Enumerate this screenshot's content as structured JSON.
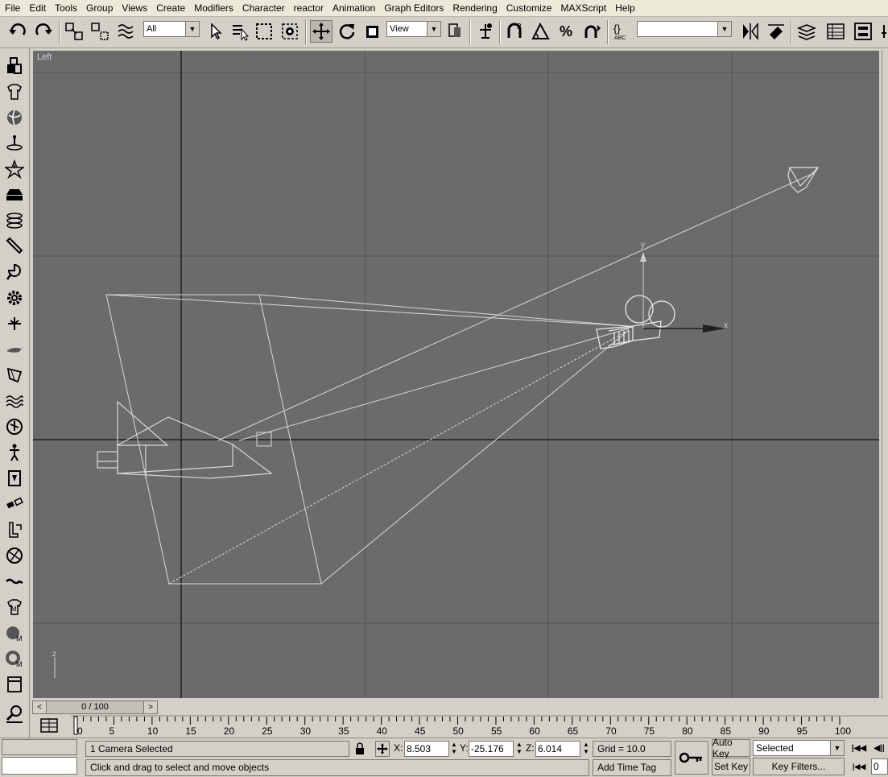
{
  "menu": [
    "File",
    "Edit",
    "Tools",
    "Group",
    "Views",
    "Create",
    "Modifiers",
    "Character",
    "reactor",
    "Animation",
    "Graph Editors",
    "Rendering",
    "Customize",
    "MAXScript",
    "Help"
  ],
  "toolbar": {
    "selection_filter": "All",
    "reference_coord": "View",
    "snap_label": "3",
    "named_selection": ""
  },
  "viewport": {
    "label": "Left",
    "axis_y": "y",
    "axis_x": "x",
    "corner_axis": "z"
  },
  "time_slider": {
    "value": "0 / 100",
    "prev": "<",
    "next": ">"
  },
  "track_ticks": [
    "0",
    "5",
    "10",
    "15",
    "20",
    "25",
    "30",
    "35",
    "40",
    "45",
    "50",
    "55",
    "60",
    "65",
    "70",
    "75",
    "80",
    "85",
    "90",
    "95",
    "100"
  ],
  "status": {
    "selection_text": "1 Camera Selected",
    "prompt_text": "Click and drag to select and move objects",
    "x_label": "X:",
    "x_value": "8.503",
    "y_label": "Y:",
    "y_value": "-25.176",
    "z_label": "Z:",
    "z_value": "6.014",
    "grid": "Grid = 10.0",
    "add_time_tag": "Add Time Tag",
    "auto_key": "Auto Key",
    "set_key": "Set Key",
    "key_mode": "Selected",
    "key_filters": "Key Filters...",
    "frame": "0"
  }
}
